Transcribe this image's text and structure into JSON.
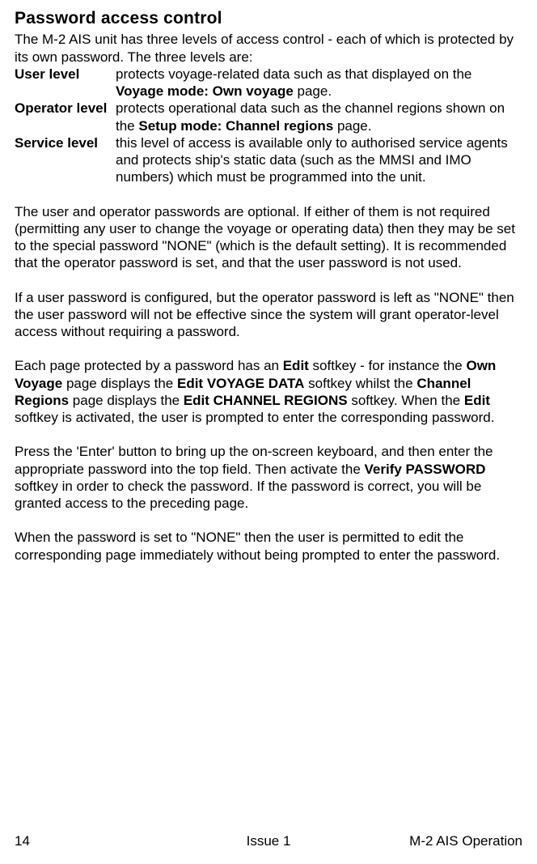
{
  "heading": "Password access control",
  "intro": "The M-2 AIS unit has three levels of access control - each of which is protected by its own password. The three levels are:",
  "levels": [
    {
      "label": "User level",
      "desc_before": "protects voyage-related data such as that displayed on the ",
      "desc_bold": "Voyage mode: Own voyage",
      "desc_after": " page."
    },
    {
      "label": "Operator level",
      "desc_before": "protects operational data such as the channel regions shown on the ",
      "desc_bold": "Setup mode: Channel regions",
      "desc_after": " page."
    },
    {
      "label": "Service level",
      "desc_before": "this level of access is available only to authorised service agents and protects ship's static data (such as the MMSI and IMO numbers) which must be programmed into the unit.",
      "desc_bold": "",
      "desc_after": ""
    }
  ],
  "para1": "The user and operator passwords are optional. If either of them is not required (permitting any user to change the voyage or operating data) then they may be set to the special password \"NONE\" (which is the default setting). It is recommended that the operator password is set, and that the user password is not used.",
  "para2": "If a user password is configured, but the operator password is left as \"NONE\" then the user password will not be effective since the system will grant operator-level access without requiring a password.",
  "para3": {
    "t1": "Each page protected by a password has an ",
    "b1": "Edit",
    "t2": " softkey - for instance the ",
    "b2": "Own Voyage",
    "t3": " page displays the ",
    "b3": "Edit VOYAGE DATA",
    "t4": " softkey whilst the ",
    "b4": "Channel Regions",
    "t5": " page displays the ",
    "b5": "Edit CHANNEL REGIONS",
    "t6": " softkey. When the ",
    "b6": "Edit",
    "t7": " softkey is activated, the user is prompted to enter the corresponding password."
  },
  "para4": {
    "t1": "Press the 'Enter' button to bring up the on-screen keyboard, and then enter the appropriate password into the top field. Then activate the ",
    "b1": "Verify PASSWORD",
    "t2": " softkey in order to check the password. If the password is correct, you will be granted access to the preceding page."
  },
  "para5": "When the password is set to \"NONE\" then the user is permitted to edit the corresponding page immediately without being prompted to enter the password.",
  "footer": {
    "left": "14",
    "center": "Issue 1",
    "right": "M-2 AIS Operation"
  }
}
